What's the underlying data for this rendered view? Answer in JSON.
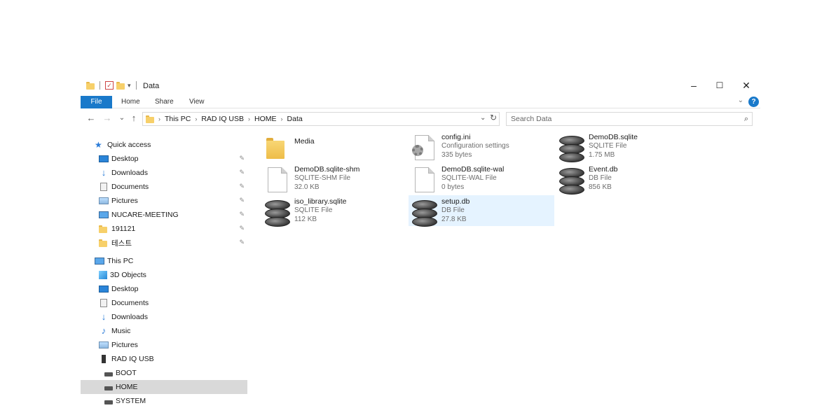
{
  "window": {
    "title": "Data",
    "minimize_glyph": "–",
    "maximize_glyph": "☐",
    "close_glyph": "✕"
  },
  "ribbon": {
    "tabs": [
      "File",
      "Home",
      "Share",
      "View"
    ],
    "help_glyph": "?",
    "expand_glyph": "⌄"
  },
  "address_bar": {
    "crumbs": [
      "This PC",
      "RAD IQ USB",
      "HOME",
      "Data"
    ],
    "separator": "›",
    "dropdown_glyph": "⌄",
    "refresh_glyph": "↻"
  },
  "search": {
    "placeholder": "Search Data",
    "icon": "search-icon"
  },
  "nav": {
    "back_glyph": "←",
    "forward_glyph": "→",
    "recent_glyph": "⌄",
    "up_glyph": "↑"
  },
  "sidebar": {
    "pin_glyph": "📌",
    "quick_access": {
      "label": "Quick access",
      "items": [
        {
          "label": "Desktop",
          "icon": "desktop-icon"
        },
        {
          "label": "Downloads",
          "icon": "downloads-icon"
        },
        {
          "label": "Documents",
          "icon": "documents-icon"
        },
        {
          "label": "Pictures",
          "icon": "pictures-icon"
        },
        {
          "label": "NUCARE-MEETING",
          "icon": "network-pc-icon"
        },
        {
          "label": "191121",
          "icon": "folder-icon"
        },
        {
          "label": "테스트",
          "icon": "folder-icon"
        }
      ]
    },
    "this_pc": {
      "label": "This PC",
      "items": [
        {
          "label": "3D Objects",
          "icon": "3d-objects-icon"
        },
        {
          "label": "Desktop",
          "icon": "desktop-icon"
        },
        {
          "label": "Documents",
          "icon": "documents-icon"
        },
        {
          "label": "Downloads",
          "icon": "downloads-icon"
        },
        {
          "label": "Music",
          "icon": "music-icon"
        },
        {
          "label": "Pictures",
          "icon": "pictures-icon"
        },
        {
          "label": "RAD IQ USB",
          "icon": "usb-drive-icon"
        }
      ],
      "usb_children": [
        {
          "label": "BOOT",
          "icon": "drive-icon"
        },
        {
          "label": "HOME",
          "icon": "drive-icon",
          "selected": true
        },
        {
          "label": "SYSTEM",
          "icon": "drive-icon"
        }
      ]
    }
  },
  "files": [
    {
      "name": "Media",
      "type": "",
      "size": "",
      "icon": "folder-icon"
    },
    {
      "name": "config.ini",
      "type": "Configuration settings",
      "size": "335 bytes",
      "icon": "config-file-icon"
    },
    {
      "name": "DemoDB.sqlite",
      "type": "SQLITE File",
      "size": "1.75 MB",
      "icon": "database-icon"
    },
    {
      "name": "DemoDB.sqlite-shm",
      "type": "SQLITE-SHM File",
      "size": "32.0 KB",
      "icon": "blank-file-icon"
    },
    {
      "name": "DemoDB.sqlite-wal",
      "type": "SQLITE-WAL File",
      "size": "0 bytes",
      "icon": "blank-file-icon"
    },
    {
      "name": "Event.db",
      "type": "DB File",
      "size": "856 KB",
      "icon": "database-icon"
    },
    {
      "name": "iso_library.sqlite",
      "type": "SQLITE File",
      "size": "112 KB",
      "icon": "database-icon"
    },
    {
      "name": "setup.db",
      "type": "DB File",
      "size": "27.8 KB",
      "icon": "database-icon",
      "selected": true
    }
  ]
}
